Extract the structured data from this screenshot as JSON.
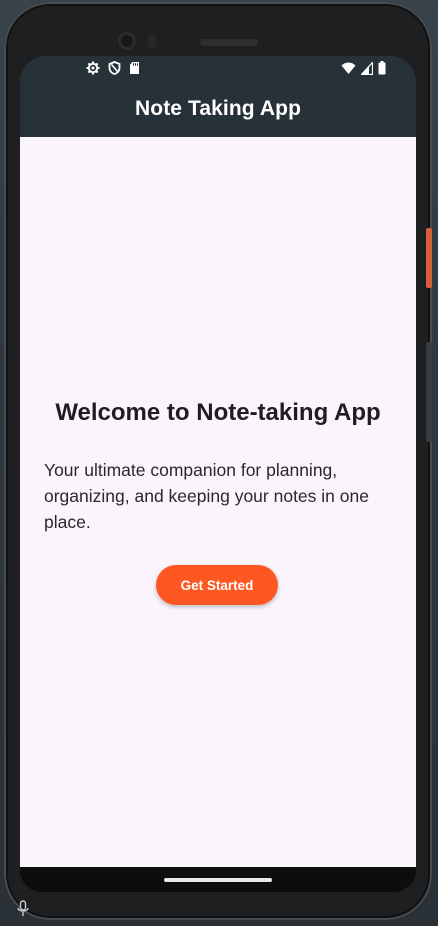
{
  "app_bar": {
    "title": "Note Taking App"
  },
  "status_bar": {
    "left_icons": [
      "gear-icon",
      "shield-icon",
      "sd-card-icon"
    ],
    "right_icons": [
      "wifi-icon",
      "signal-icon",
      "battery-icon"
    ]
  },
  "welcome": {
    "title": "Welcome to Note-taking App",
    "tagline": "Your ultimate companion for planning, organizing, and keeping your notes in one place."
  },
  "cta": {
    "label": "Get Started"
  },
  "colors": {
    "app_bar": "#263238",
    "background": "#fcf4fc",
    "button": "#ff5722",
    "button_text": "#ffffff",
    "title_text": "#1f1d22"
  }
}
